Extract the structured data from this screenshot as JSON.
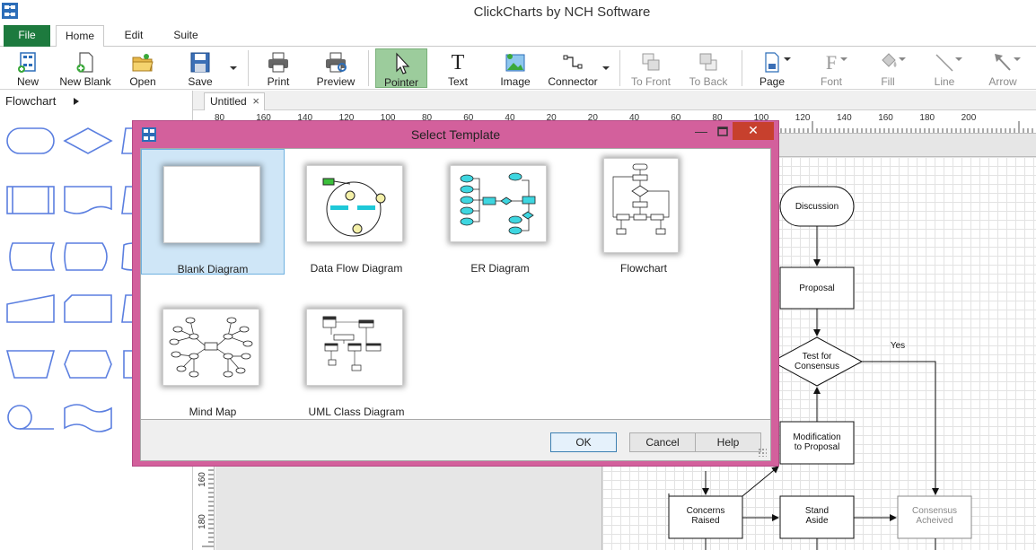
{
  "app": {
    "title": "ClickCharts by NCH Software"
  },
  "tabs": {
    "file": "File",
    "home": "Home",
    "edit": "Edit",
    "suite": "Suite"
  },
  "toolbar": {
    "new": "New",
    "new_blank": "New Blank",
    "open": "Open",
    "save": "Save",
    "print": "Print",
    "preview": "Preview",
    "pointer": "Pointer",
    "text": "Text",
    "image": "Image",
    "connector": "Connector",
    "to_front": "To Front",
    "to_back": "To Back",
    "page": "Page",
    "font": "Font",
    "fill": "Fill",
    "line": "Line",
    "arrow": "Arrow",
    "text_glyph": "T",
    "font_glyph": "F"
  },
  "left_panel": {
    "category": "Flowchart"
  },
  "document": {
    "tab": "Untitled",
    "close_glyph": "×"
  },
  "ruler": {
    "h_labels": [
      "80",
      "160",
      "140",
      "120",
      "100",
      "80",
      "60",
      "40",
      "20",
      "20",
      "40",
      "60",
      "80",
      "100",
      "120",
      "140",
      "160",
      "180",
      "200"
    ],
    "v_labels": [
      "160",
      "180"
    ]
  },
  "flowchart": {
    "discussion": "Discussion",
    "proposal": "Proposal",
    "test_line1": "Test for",
    "test_line2": "Consensus",
    "yes": "Yes",
    "mod_line1": "Modification",
    "mod_line2": "to Proposal",
    "concerns_line1": "Concerns",
    "concerns_line2": "Raised",
    "stand_line1": "Stand",
    "stand_line2": "Aside",
    "consensus_line1": "Consensus",
    "consensus_line2": "Acheived"
  },
  "dialog": {
    "title": "Select Template",
    "min_glyph": "—",
    "close_glyph": "✕",
    "templates": [
      {
        "label": "Blank Diagram",
        "selected": true
      },
      {
        "label": "Data Flow Diagram"
      },
      {
        "label": "ER Diagram"
      },
      {
        "label": "Flowchart"
      },
      {
        "label": "Mind Map"
      },
      {
        "label": "UML Class Diagram"
      }
    ],
    "ok": "OK",
    "cancel": "Cancel",
    "help": "Help"
  },
  "colors": {
    "file_tab": "#1d7a3e",
    "dialog_frame": "#d3609c",
    "close_button": "#c7402d",
    "selection": "#cfe6f7",
    "shape_stroke": "#5b7fe0",
    "pointer_active": "#9ccc9c"
  }
}
